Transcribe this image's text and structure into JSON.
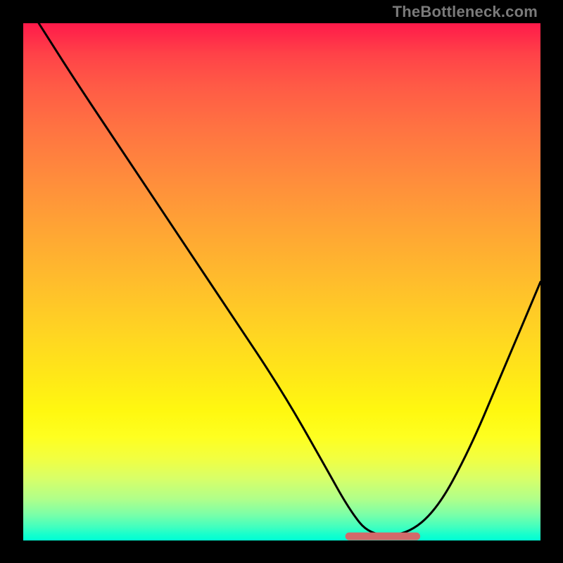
{
  "watermark": "TheBottleneck.com",
  "colors": {
    "page_bg": "#000000",
    "gradient_top": "#ff1a4a",
    "gradient_bottom": "#00ffd4",
    "curve_stroke": "#000000",
    "flat_segment": "#d26a6a",
    "watermark": "#7a7a7a"
  },
  "chart_data": {
    "type": "line",
    "title": "",
    "xlabel": "",
    "ylabel": "",
    "xlim": [
      0,
      100
    ],
    "ylim": [
      0,
      100
    ],
    "grid": false,
    "series": [
      {
        "name": "main-curve",
        "x": [
          3,
          10,
          20,
          30,
          40,
          50,
          58,
          63,
          67,
          74,
          80,
          86,
          92,
          100
        ],
        "values": [
          100,
          89,
          74,
          59,
          44,
          29,
          15,
          6,
          1,
          1,
          6,
          17,
          31,
          50
        ]
      }
    ],
    "flat_segment_x": [
      63,
      76
    ],
    "flat_segment_y": 0.8
  }
}
